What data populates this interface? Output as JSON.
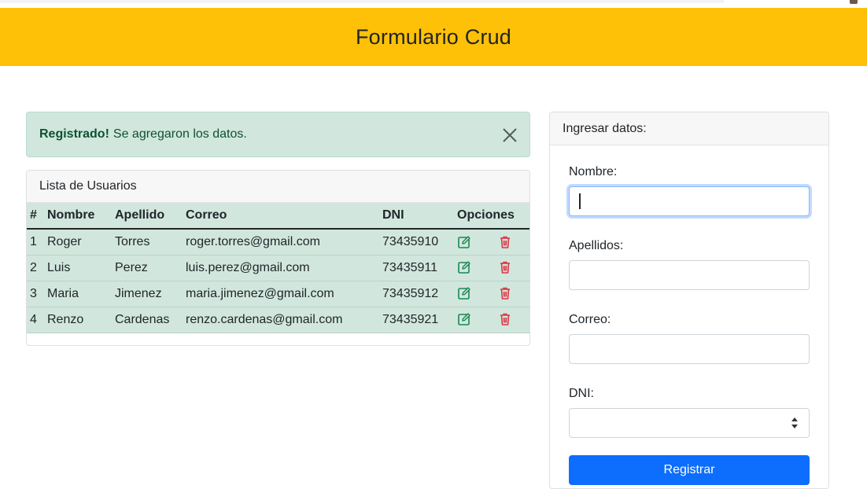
{
  "header": {
    "title": "Formulario Crud"
  },
  "alert": {
    "strong": "Registrado!",
    "message": "Se agregaron los datos."
  },
  "user_list": {
    "title": "Lista de Usuarios",
    "columns": [
      "#",
      "Nombre",
      "Apellido",
      "Correo",
      "DNI",
      "Opciones"
    ],
    "rows": [
      {
        "num": "1",
        "nombre": "Roger",
        "apellido": "Torres",
        "correo": "roger.torres@gmail.com",
        "dni": "73435910"
      },
      {
        "num": "2",
        "nombre": "Luis",
        "apellido": "Perez",
        "correo": "luis.perez@gmail.com",
        "dni": "73435911"
      },
      {
        "num": "3",
        "nombre": "Maria",
        "apellido": "Jimenez",
        "correo": "maria.jimenez@gmail.com",
        "dni": "73435912"
      },
      {
        "num": "4",
        "nombre": "Renzo",
        "apellido": "Cardenas",
        "correo": "renzo.cardenas@gmail.com",
        "dni": "73435921"
      }
    ],
    "icons": {
      "edit": "edit-icon",
      "delete": "trash-icon"
    }
  },
  "form": {
    "title": "Ingresar datos:",
    "fields": [
      {
        "label": "Nombre:",
        "value": ""
      },
      {
        "label": "Apellidos:",
        "value": ""
      },
      {
        "label": "Correo:",
        "value": ""
      },
      {
        "label": "DNI:",
        "value": ""
      }
    ],
    "submit_label": "Registrar"
  },
  "colors": {
    "header_bg": "#ffc107",
    "alert_bg": "#d1e7dd",
    "alert_text": "#0f5132",
    "edit_icon": "#198754",
    "delete_icon": "#dc3545",
    "primary": "#0d6efd"
  }
}
